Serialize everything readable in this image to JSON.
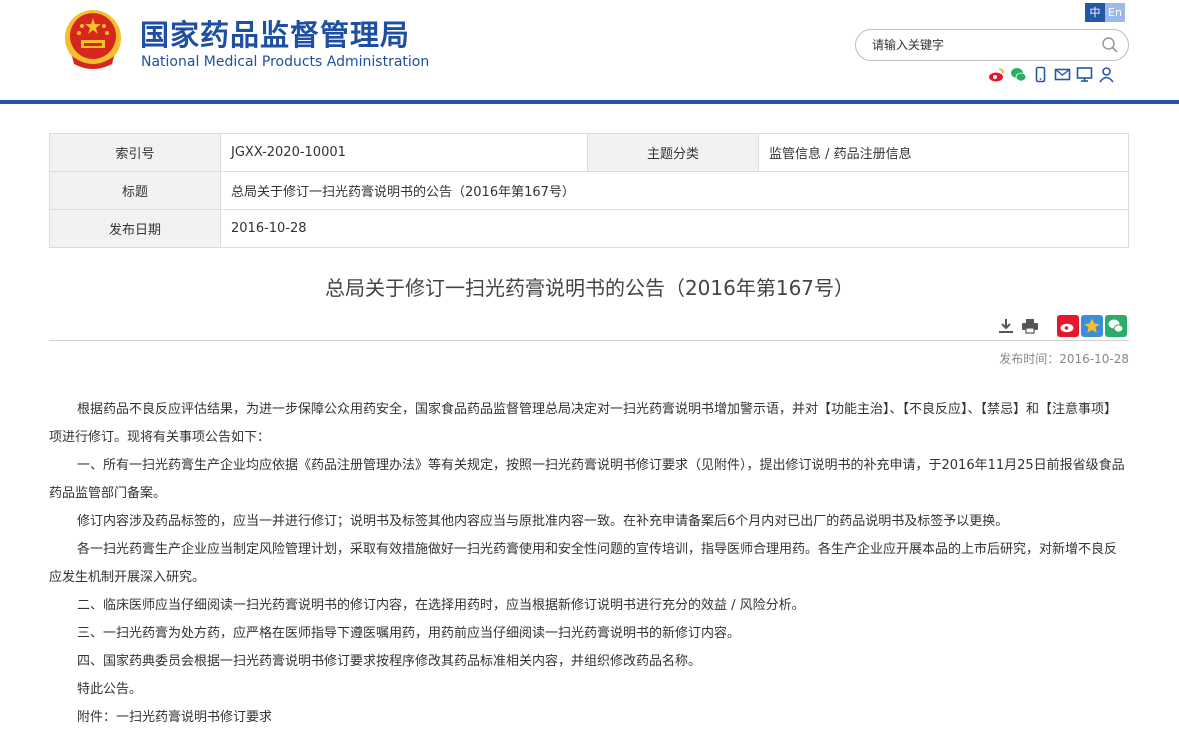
{
  "header": {
    "site_name_cn": "国家药品监督管理局",
    "site_name_en": "National Medical Products Administration",
    "lang_cn": "中",
    "lang_en": "En",
    "search_placeholder": "请输入关键字",
    "social_icons": [
      "weibo-icon",
      "wechat-icon",
      "mobile-icon",
      "mail-icon",
      "feedback-icon",
      "user-icon"
    ]
  },
  "info": {
    "index_label": "索引号",
    "index_value": "JGXX-2020-10001",
    "category_label": "主题分类",
    "category_value": "监管信息 / 药品注册信息",
    "title_label": "标题",
    "title_value": "总局关于修订一扫光药膏说明书的公告（2016年第167号）",
    "date_label": "发布日期",
    "date_value": "2016-10-28"
  },
  "article": {
    "title": "总局关于修订一扫光药膏说明书的公告（2016年第167号）",
    "publish_time": "发布时间：2016-10-28",
    "paragraphs": [
      "根据药品不良反应评估结果，为进一步保障公众用药安全，国家食品药品监督管理总局决定对一扫光药膏说明书增加警示语，并对【功能主治】、【不良反应】、【禁忌】和【注意事项】项进行修订。现将有关事项公告如下：",
      "一、所有一扫光药膏生产企业均应依据《药品注册管理办法》等有关规定，按照一扫光药膏说明书修订要求（见附件），提出修订说明书的补充申请，于2016年11月25日前报省级食品药品监管部门备案。",
      "修订内容涉及药品标签的，应当一并进行修订；说明书及标签其他内容应当与原批准内容一致。在补充申请备案后6个月内对已出厂的药品说明书及标签予以更换。",
      "各一扫光药膏生产企业应当制定风险管理计划，采取有效措施做好一扫光药膏使用和安全性问题的宣传培训，指导医师合理用药。各生产企业应开展本品的上市后研究，对新增不良反应发生机制开展深入研究。",
      "二、临床医师应当仔细阅读一扫光药膏说明书的修订内容，在选择用药时，应当根据新修订说明书进行充分的效益 / 风险分析。",
      "三、一扫光药膏为处方药，应严格在医师指导下遵医嘱用药，用药前应当仔细阅读一扫光药膏说明书的新修订内容。",
      "四、国家药典委员会根据一扫光药膏说明书修订要求按程序修改其药品标准相关内容，并组织修改药品名称。",
      "特此公告。",
      "附件：一扫光药膏说明书修订要求"
    ]
  },
  "colors": {
    "brand_blue": "#1f4fa0",
    "header_rule": "#2557a7",
    "emblem_red": "#d7261e",
    "emblem_gold": "#f3c02c"
  }
}
